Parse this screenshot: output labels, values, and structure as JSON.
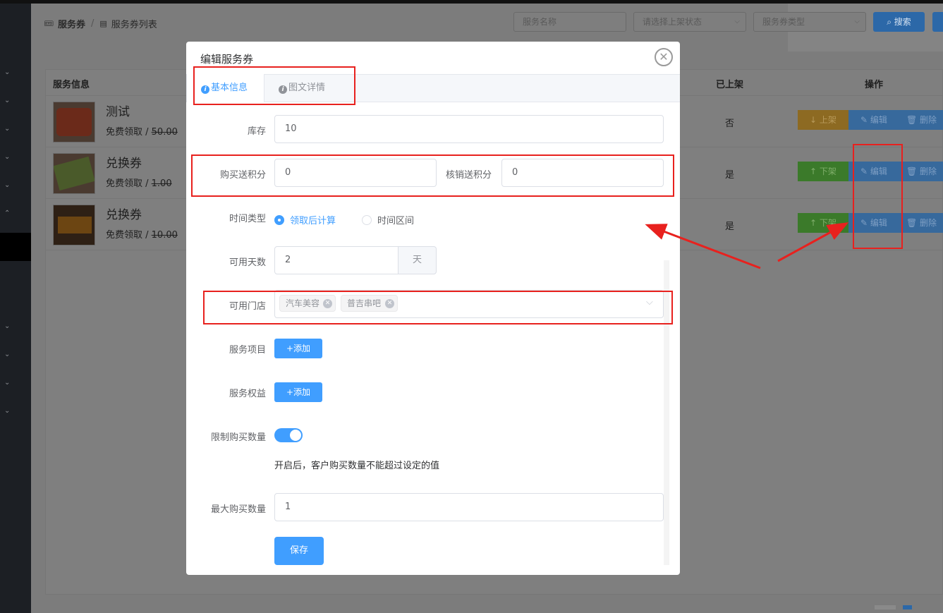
{
  "breadcrumb": {
    "root": "服务券",
    "separator": "/",
    "current": "服务券列表"
  },
  "filters": {
    "name_placeholder": "服务名称",
    "status_placeholder": "请选择上架状态",
    "type_placeholder": "服务券类型",
    "search_label": "搜索"
  },
  "table": {
    "headers": {
      "info": "服务信息",
      "shelved": "已上架",
      "actions": "操作"
    },
    "rows": [
      {
        "name": "测试",
        "price_prefix": "免费领取 / ",
        "price": "50.00",
        "shelved": "否",
        "toggle": "上架"
      },
      {
        "name": "兑换券",
        "price_prefix": "免费领取 / ",
        "price": "1.00",
        "shelved": "是",
        "toggle": "下架"
      },
      {
        "name": "兑换券",
        "price_prefix": "免费领取 / ",
        "price": "10.00",
        "shelved": "是",
        "toggle": "下架"
      }
    ],
    "edit_label": "编辑",
    "delete_label": "删除"
  },
  "modal": {
    "title": "编辑服务券",
    "tabs": [
      {
        "label": "基本信息",
        "active": true
      },
      {
        "label": "图文详情",
        "active": false
      }
    ],
    "form": {
      "stock_label": "库存",
      "stock_value": "10",
      "buy_points_label": "购买送积分",
      "buy_points_value": "0",
      "verify_points_label": "核销送积分",
      "verify_points_value": "0",
      "time_type_label": "时间类型",
      "time_options": [
        {
          "label": "领取后计算",
          "selected": true
        },
        {
          "label": "时间区间",
          "selected": false
        }
      ],
      "days_label": "可用天数",
      "days_value": "2",
      "days_unit": "天",
      "stores_label": "可用门店",
      "stores": [
        "汽车美容",
        "普吉串吧"
      ],
      "items_label": "服务项目",
      "items_add": "+添加",
      "benefits_label": "服务权益",
      "benefits_add": "+添加",
      "limit_label": "限制购买数量",
      "limit_enabled": true,
      "limit_tip": "开启后，客户购买数量不能超过设定的值",
      "max_label": "最大购买数量",
      "max_value": "1",
      "save_label": "保存"
    }
  },
  "colors": {
    "primary": "#409eff",
    "annotation": "#e8211e",
    "overlay": "#6e6e6e"
  }
}
